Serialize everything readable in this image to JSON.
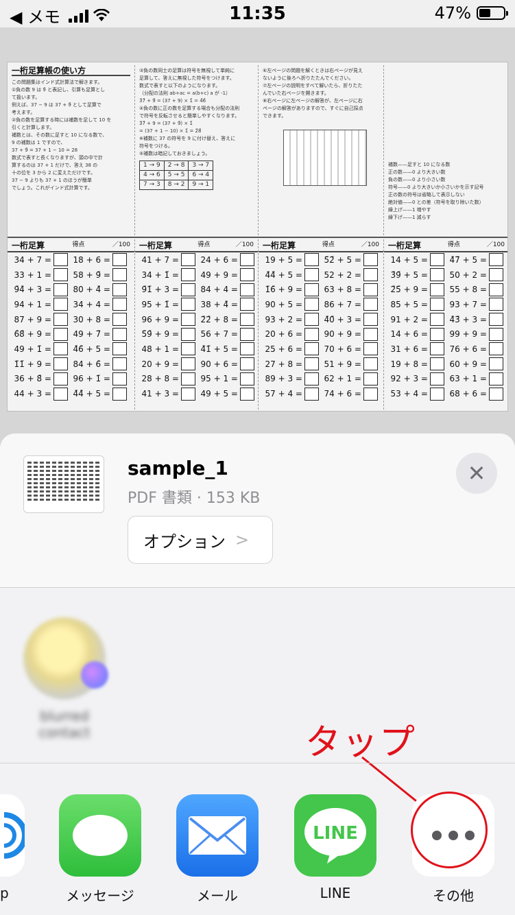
{
  "status_bar": {
    "back_app": "◀ メモ",
    "time": "11:35",
    "battery_percent": "47%",
    "battery_level": 0.47
  },
  "pdf": {
    "panel1_title": "一桁足算帳の使い方",
    "panel1_lines": [
      "この問題集はインド式計算法で解きます。",
      "①負の数 9 は 9̄ と表記し、引算も足算とし",
      "て扱います。",
      "例えば、37 − 9 は 37 + 9̄ として足算で",
      "考えます。",
      "②負の数を足算する時には補数を足して 10 を",
      "引くと計算します。",
      "補数とは、その数に足すと 10 になる数で、",
      "9 の補数は 1 ですので、",
      "37 + 9̄ = 37 + 1 − 10 = 28",
      "数式で表すと長くなりますが、頭の中で計",
      "算するのは 37 + 1 だけで、答え 38 の",
      "十の位を 3 から 2 に変えただけです。",
      "37 − 9 よりも 37 + 1 のほうが簡単",
      "でしょう。これがインド式計算です。"
    ],
    "panel2_lines": [
      "③負の数同士の足算は符号を無視して単純に",
      "足算して、答えに無視した符号をつけます。",
      "数式で表すと以下のようになります。",
      "（分配の法則 ab+ac = a(b+c) a が -1）",
      "3̄7̄ + 9̄ = (37 + 9) × 1̄ = 4̄6̄",
      "④負の数に正の数を足算する場合も分配の法則",
      "で符号を反転させると簡単しやすくなります。",
      "3̄7̄ + 9 = (37 + 9̄) × 1̄",
      "= (37 + 1 − 10) × 1̄ = 2̄8̄",
      "※補数に 37 の符号を 9 に付け替え、答えに",
      "符号をつける。",
      "⑤補数は暗記しておきましょう。"
    ],
    "complement_table": [
      [
        "1 → 9",
        "2 → 8",
        "3 → 7"
      ],
      [
        "4 → 6",
        "5 → 5",
        "6 → 4"
      ],
      [
        "7 → 3",
        "8 → 2",
        "9 → 1"
      ]
    ],
    "panel3_lines": [
      "⑥左ページの問題を解くときは右ページが見え",
      "ないように後ろへ折りたたんでください。",
      "⑦左ページの説明をすべて解いたら、折りたた",
      "んでいた右ページを開きます。",
      "⑧右ページに左ページの解答が、左ページに右",
      "ページの解答がありますので、すぐに自己採点",
      "できます。"
    ],
    "panel4_lines": [
      "補数——足すと 10 になる数",
      "正の数——0 より大きい数",
      "負の数——0 より小さい数",
      "符号——0 より大きいか小さいかを示す記号",
      "正の数の符号は省略して表示しない",
      "絶対値——0 との差（符号を取り除いた数）",
      "繰上げ——1 増やす",
      "繰下げ——1 減らす"
    ],
    "columns": [
      {
        "title": "一桁足算",
        "score": "得点",
        "max": "／100",
        "rows": [
          [
            "34 + 7 =",
            "18 + 6 ="
          ],
          [
            "33 + 1 =",
            "58 + 9̄ ="
          ],
          [
            "9̄4̄ + 3 =",
            "80 + 4̄ ="
          ],
          [
            "94 + 1 =",
            "34 + 4 ="
          ],
          [
            "87 + 9 =",
            "30 + 8 ="
          ],
          [
            "6̄8̄ + 9 =",
            "49 + 7̄ ="
          ],
          [
            "49 + 1̄ =",
            "4̄6̄ + 5 ="
          ],
          [
            "1̄1̄ + 9 =",
            "84 + 6̄ ="
          ],
          [
            "36 + 8̄ =",
            "96 + 1̄ ="
          ],
          [
            "44 + 3 =",
            "4̄4̄ + 5 ="
          ]
        ]
      },
      {
        "title": "一桁足算",
        "score": "得点",
        "max": "／100",
        "rows": [
          [
            "41 + 7 =",
            "24 + 6 ="
          ],
          [
            "34 + 1̄ =",
            "49 + 9 ="
          ],
          [
            "9̄1̄ + 3 =",
            "84 + 4 ="
          ],
          [
            "95 + 1̄ =",
            "38 + 4̄ ="
          ],
          [
            "96 + 9 =",
            "2̄2̄ + 8 ="
          ],
          [
            "5̄9̄ + 9 =",
            "56 + 7 ="
          ],
          [
            "48 + 1 =",
            "4̄1̄ + 5 ="
          ],
          [
            "20 + 9 =",
            "90 + 6 ="
          ],
          [
            "28 + 8 =",
            "95 + 1 ="
          ],
          [
            "41 + 3 =",
            "49 + 5 ="
          ]
        ]
      },
      {
        "title": "一桁足算",
        "score": "得点",
        "max": "／100",
        "rows": [
          [
            "19 + 5 =",
            "5̄2̄ + 5 ="
          ],
          [
            "4̄4̄ + 5 =",
            "52 + 2 ="
          ],
          [
            "1̄6̄ + 9 =",
            "63 + 8 ="
          ],
          [
            "90 + 5 =",
            "86 + 7 ="
          ],
          [
            "93 + 2 =",
            "4̄0̄ + 3 ="
          ],
          [
            "20 + 6 =",
            "90 + 9 ="
          ],
          [
            "25 + 6 =",
            "70 + 6 ="
          ],
          [
            "27 + 8 =",
            "51 + 9 ="
          ],
          [
            "89 + 3 =",
            "62 + 1 ="
          ],
          [
            "57 + 4 =",
            "74 + 6 ="
          ]
        ]
      },
      {
        "title": "一桁足算",
        "score": "得点",
        "max": "／100",
        "rows": [
          [
            "14 + 5 =",
            "4̄7̄ + 5 ="
          ],
          [
            "3̄9̄ + 5 =",
            "50 + 2 ="
          ],
          [
            "2̄5̄ + 9 =",
            "55 + 8 ="
          ],
          [
            "85 + 5 =",
            "93 + 7 ="
          ],
          [
            "91 + 2 =",
            "4̄3̄ + 3 ="
          ],
          [
            "14 + 6 =",
            "99 + 9 ="
          ],
          [
            "31 + 6 =",
            "76 + 6 ="
          ],
          [
            "19 + 8 =",
            "60 + 9 ="
          ],
          [
            "92 + 3 =",
            "63 + 1 ="
          ],
          [
            "53 + 4 =",
            "68 + 6 ="
          ]
        ]
      }
    ]
  },
  "share_sheet": {
    "file_name": "sample_1",
    "file_info": "PDF 書類 · 153 KB",
    "options_label": "オプション",
    "options_chevron": ">",
    "close_symbol": "✕",
    "contact_name": "blurred contact",
    "annotation_text": "タップ",
    "annotation_color": "#e0121a",
    "partial_app_label": "p",
    "apps": [
      {
        "label": "メッセージ",
        "icon": "messages-icon"
      },
      {
        "label": "メール",
        "icon": "mail-icon"
      },
      {
        "label": "LINE",
        "icon": "line-icon",
        "icon_text": "LINE"
      },
      {
        "label": "その他",
        "icon": "more-icon"
      }
    ]
  }
}
